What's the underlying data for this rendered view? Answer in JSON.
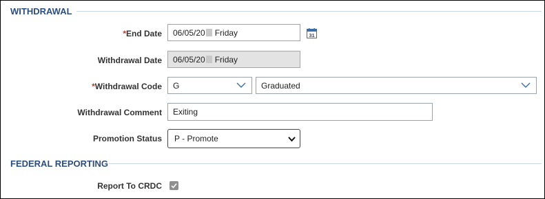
{
  "sections": {
    "withdrawal": "WITHDRAWAL",
    "federal": "FEDERAL REPORTING"
  },
  "fields": {
    "end_date": {
      "required_mark": "*",
      "label": "End Date",
      "value_prefix": "06/05/20",
      "value_suffix": "Friday"
    },
    "withdrawal_date": {
      "label": "Withdrawal Date",
      "value_prefix": "06/05/20",
      "value_suffix": "Friday"
    },
    "withdrawal_code": {
      "required_mark": "*",
      "label": "Withdrawal Code",
      "code_value": "G",
      "description_value": "Graduated"
    },
    "withdrawal_comment": {
      "label": "Withdrawal Comment",
      "value": "Exiting"
    },
    "promotion_status": {
      "label": "Promotion Status",
      "value": "P - Promote"
    },
    "report_to_crdc": {
      "label": "Report To CRDC",
      "checked": true
    }
  },
  "icons": {
    "calendar": "calendar-icon",
    "calendar_day": "31",
    "dropdown": "chevron-down-icon",
    "checkbox": "check-icon"
  },
  "colors": {
    "section_title": "#2d4e7d",
    "required": "#c0392b",
    "readonly_bg": "#e3e3e3",
    "dropdown_chevron": "#3a6ea5"
  }
}
